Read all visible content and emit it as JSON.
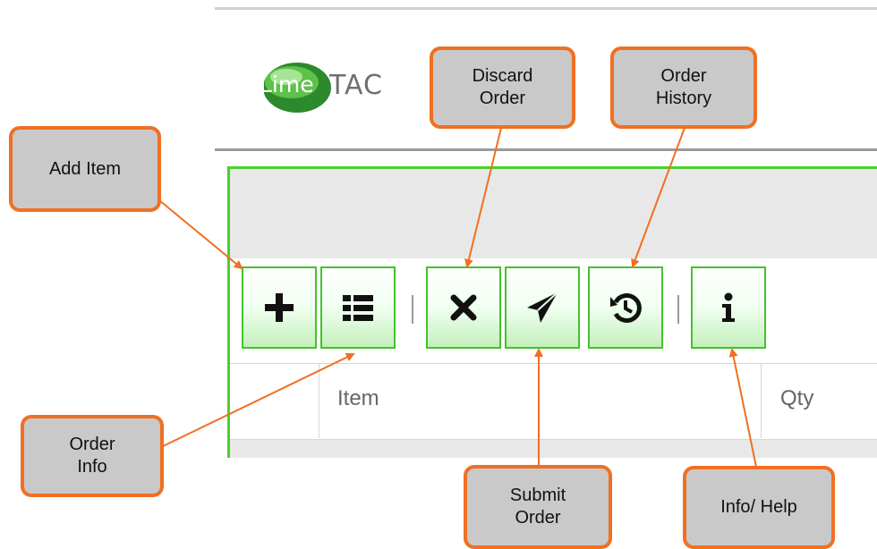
{
  "logo": {
    "lime": "Lime",
    "tac": "TAC"
  },
  "toolbar": {
    "buttons": [
      {
        "icon": "plus-icon"
      },
      {
        "icon": "list-icon"
      },
      {
        "icon": "times-icon"
      },
      {
        "icon": "paper-plane-icon"
      },
      {
        "icon": "history-icon"
      },
      {
        "icon": "info-icon"
      }
    ]
  },
  "table": {
    "columns": [
      "Item",
      "Qty"
    ]
  },
  "callouts": {
    "add_item": "Add Item",
    "order_info": "Order\nInfo",
    "discard_order": "Discard\nOrder",
    "order_history": "Order\nHistory",
    "submit_order": "Submit\nOrder",
    "info_help": "Info/ Help"
  },
  "colors": {
    "accent": "#f07023",
    "toolbar_border": "#44c22c",
    "panel_border": "#4ccf2f",
    "callout_bg": "#c9c9c9"
  }
}
